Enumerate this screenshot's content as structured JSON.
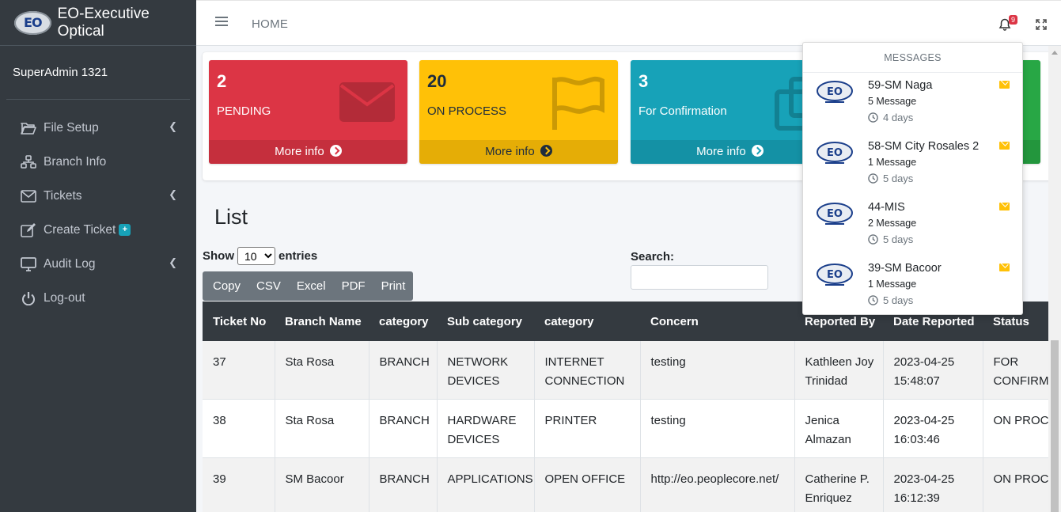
{
  "app": {
    "title": "EO-Executive Optical",
    "logo_text": "EO"
  },
  "user": {
    "name": "SuperAdmin 1321"
  },
  "sidebar": {
    "items": [
      {
        "label": "File Setup",
        "icon": "folder-open-icon",
        "has_arrow": true
      },
      {
        "label": "Branch Info",
        "icon": "network-icon",
        "has_arrow": false
      },
      {
        "label": "Tickets",
        "icon": "envelope-icon",
        "has_arrow": true
      },
      {
        "label": "Create Ticket",
        "icon": "edit-icon",
        "has_arrow": false,
        "badge": "+"
      },
      {
        "label": "Audit Log",
        "icon": "desktop-icon",
        "has_arrow": true
      },
      {
        "label": "Log-out",
        "icon": "power-icon",
        "has_arrow": false
      }
    ]
  },
  "header": {
    "home": "HOME",
    "notification_count": "9"
  },
  "stats": [
    {
      "value": "2",
      "label": "PENDING",
      "more": "More info",
      "color": "#dc3545",
      "icon": "envelope-icon"
    },
    {
      "value": "20",
      "label": "ON PROCESS",
      "more": "More info",
      "color": "#ffc107",
      "icon": "flag-icon"
    },
    {
      "value": "3",
      "label": "For Confirmation",
      "more": "More info",
      "color": "#17a2b8",
      "icon": "copy-icon"
    },
    {
      "value": "",
      "label": "",
      "more": "",
      "color": "#28a745",
      "icon": ""
    }
  ],
  "list": {
    "title": "List",
    "show_label": "Show",
    "entries_value": "10",
    "entries_label": "entries",
    "search_label": "Search:",
    "buttons": [
      "Copy",
      "CSV",
      "Excel",
      "PDF",
      "Print"
    ],
    "columns": [
      "Ticket No",
      "Branch Name",
      "category",
      "Sub category",
      "category",
      "Concern",
      "Reported By",
      "Date Reported",
      "Status"
    ],
    "rows": [
      {
        "ticket_no": "37",
        "branch": "Sta Rosa",
        "category": "BRANCH",
        "sub_category": "NETWORK DEVICES",
        "category2": "INTERNET CONNECTION",
        "concern": "testing",
        "reported_by": "Kathleen Joy Trinidad",
        "date": "2023-04-25 15:48:07",
        "status": "FOR CONFIRMA"
      },
      {
        "ticket_no": "38",
        "branch": "Sta Rosa",
        "category": "BRANCH",
        "sub_category": "HARDWARE DEVICES",
        "category2": "PRINTER",
        "concern": "testing",
        "reported_by": "Jenica Almazan",
        "date": "2023-04-25 16:03:46",
        "status": "ON PROCE"
      },
      {
        "ticket_no": "39",
        "branch": "SM Bacoor",
        "category": "BRANCH",
        "sub_category": "APPLICATIONS",
        "category2": "OPEN OFFICE",
        "concern": "http://eo.peoplecore.net/",
        "reported_by": "Catherine P. Enriquez",
        "date": "2023-04-25 16:12:39",
        "status": "ON PROCE"
      }
    ]
  },
  "messages": {
    "header": "MESSAGES",
    "items": [
      {
        "name": "59-SM Naga",
        "count": "5 Message",
        "time": "4 days"
      },
      {
        "name": "58-SM City Rosales 2",
        "count": "1 Message",
        "time": "5 days"
      },
      {
        "name": "44-MIS",
        "count": "2 Message",
        "time": "5 days"
      },
      {
        "name": "39-SM Bacoor",
        "count": "1 Message",
        "time": "5 days"
      }
    ]
  }
}
